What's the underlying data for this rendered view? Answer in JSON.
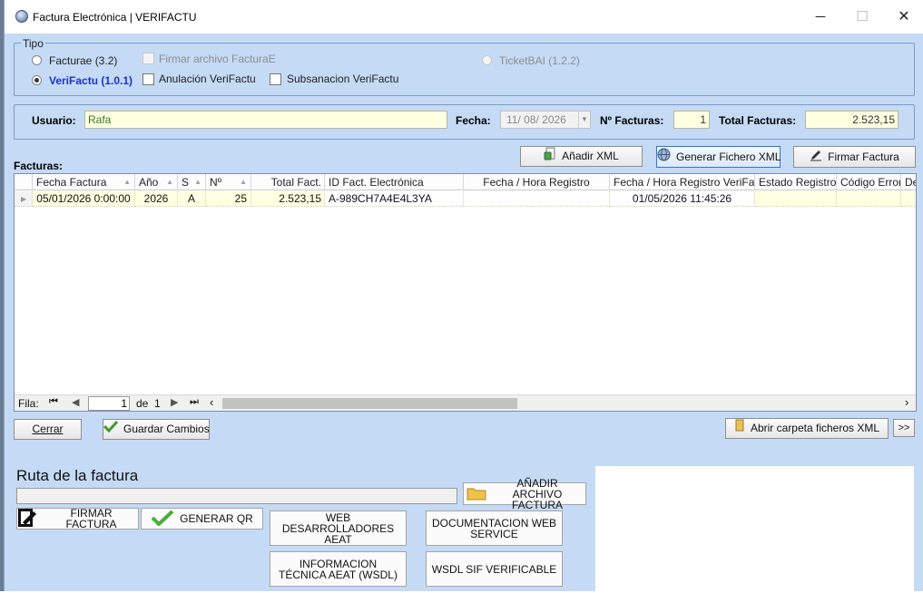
{
  "window": {
    "title": "Factura Electrónica  |  VERIFACTU",
    "min_label": "─",
    "max_label": "☐",
    "close_label": "✕"
  },
  "tipo": {
    "legend": "Tipo",
    "facturae": "Facturae (3.2)",
    "verifactu": "VeriFactu (1.0.1)",
    "firmar_archivo": "Firmar archivo FacturaE",
    "anulacion": "Anulación VeriFactu",
    "subsanacion": "Subsanacion VeriFactu",
    "ticketbai": "TicketBAI (1.2.2)",
    "selected": "VeriFactu (1.0.1)"
  },
  "header": {
    "usuario_label": "Usuario:",
    "usuario_value": "Rafa",
    "fecha_label": "Fecha:",
    "fecha_value": "11/ 08/ 2026",
    "nfacturas_label": "Nº Facturas:",
    "nfacturas_value": "1",
    "total_label": "Total Facturas:",
    "total_value": "2.523,15"
  },
  "facturas_label": "Facturas:",
  "toolbar": {
    "anadir_xml": "Añadir XML",
    "generar_xml": "Generar Fichero XML",
    "firmar_factura": "Firmar Factura"
  },
  "grid": {
    "columns": [
      "Fecha Factura",
      "Año",
      "S",
      "Nº",
      "Total Fact.",
      "ID Fact. Electrónica",
      "Fecha / Hora Registro",
      "Fecha / Hora Registro VeriFa...",
      "Estado Registro",
      "Código Error",
      "De"
    ],
    "rows": [
      [
        "05/01/2026 0:00:00",
        "2026",
        "A",
        "25",
        "2.523,15",
        "A-989CH7A4E4L3YA",
        "",
        "01/05/2026 11:45:26",
        "",
        "",
        ""
      ]
    ],
    "nav": {
      "fila_label": "Fila:",
      "current": "1",
      "de_label": "de",
      "total": "1"
    }
  },
  "buttons": {
    "cerrar": "Cerrar",
    "guardar": "Guardar Cambios",
    "abrir_carpeta": "Abrir carpeta ficheros XML",
    "more": ">>"
  },
  "ruta": {
    "label": "Ruta de la factura",
    "value": "",
    "anadir_archivo": "AÑADIR ARCHIVO FACTURA",
    "firmar": "FIRMAR FACTURA",
    "generar_qr": "GENERAR QR",
    "web_desarrolladores": "WEB DESARROLLADORES AEAT",
    "documentacion": "DOCUMENTACION WEB SERVICE",
    "informacion_tecnica": "INFORMACION TÉCNICA AEAT (WSDL)",
    "wsdl_sif": "WSDL SIF VERIFICABLE"
  }
}
